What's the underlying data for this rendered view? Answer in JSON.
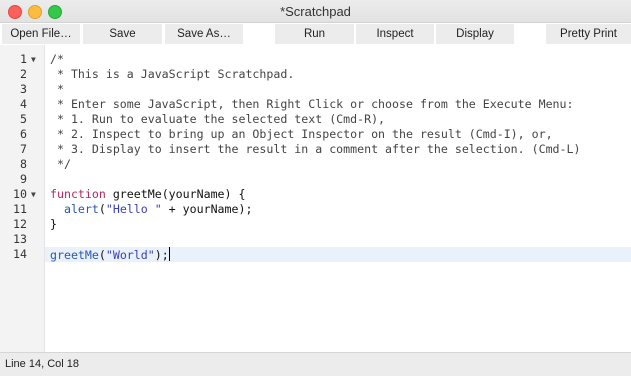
{
  "window": {
    "title": "*Scratchpad"
  },
  "toolbar": {
    "open_file": "Open File…",
    "save": "Save",
    "save_as": "Save As…",
    "run": "Run",
    "inspect": "Inspect",
    "display": "Display",
    "pretty_print": "Pretty Print"
  },
  "editor": {
    "line_numbers": [
      "1",
      "2",
      "3",
      "4",
      "5",
      "6",
      "7",
      "8",
      "9",
      "10",
      "11",
      "12",
      "13",
      "14"
    ],
    "fold_markers": {
      "1": "▼",
      "10": "▼"
    },
    "lines": [
      {
        "tokens": [
          {
            "text": "/*",
            "kind": "comment"
          }
        ]
      },
      {
        "tokens": [
          {
            "text": " * This is a JavaScript Scratchpad.",
            "kind": "comment"
          }
        ]
      },
      {
        "tokens": [
          {
            "text": " *",
            "kind": "comment"
          }
        ]
      },
      {
        "tokens": [
          {
            "text": " * Enter some JavaScript, then Right Click or choose from the Execute Menu:",
            "kind": "comment"
          }
        ]
      },
      {
        "tokens": [
          {
            "text": " * 1. Run to evaluate the selected text (Cmd-R),",
            "kind": "comment"
          }
        ]
      },
      {
        "tokens": [
          {
            "text": " * 2. Inspect to bring up an Object Inspector on the result (Cmd-I), or,",
            "kind": "comment"
          }
        ]
      },
      {
        "tokens": [
          {
            "text": " * 3. Display to insert the result in a comment after the selection. (Cmd-L)",
            "kind": "comment"
          }
        ]
      },
      {
        "tokens": [
          {
            "text": " */",
            "kind": "comment"
          }
        ]
      },
      {
        "tokens": []
      },
      {
        "tokens": [
          {
            "text": "function",
            "kind": "keyword"
          },
          {
            "text": " ",
            "kind": "plain"
          },
          {
            "text": "greetMe",
            "kind": "plain"
          },
          {
            "text": "(yourName) {",
            "kind": "plain"
          }
        ]
      },
      {
        "tokens": [
          {
            "text": "  ",
            "kind": "plain"
          },
          {
            "text": "alert",
            "kind": "func"
          },
          {
            "text": "(",
            "kind": "plain"
          },
          {
            "text": "\"Hello \"",
            "kind": "string"
          },
          {
            "text": " + yourName);",
            "kind": "plain"
          }
        ]
      },
      {
        "tokens": [
          {
            "text": "}",
            "kind": "plain"
          }
        ]
      },
      {
        "tokens": []
      },
      {
        "tokens": [
          {
            "text": "greetMe",
            "kind": "func"
          },
          {
            "text": "(",
            "kind": "plain"
          },
          {
            "text": "\"World\"",
            "kind": "string"
          },
          {
            "text": ");",
            "kind": "plain"
          }
        ]
      }
    ],
    "active_line": 14
  },
  "status": {
    "cursor": "Line 14, Col 18"
  },
  "colors": {
    "comment": "#444444",
    "keyword": "#b4295e",
    "func": "#2a57b3",
    "string": "#3a3fb7",
    "active_line_bg": "#e9f1fb"
  }
}
